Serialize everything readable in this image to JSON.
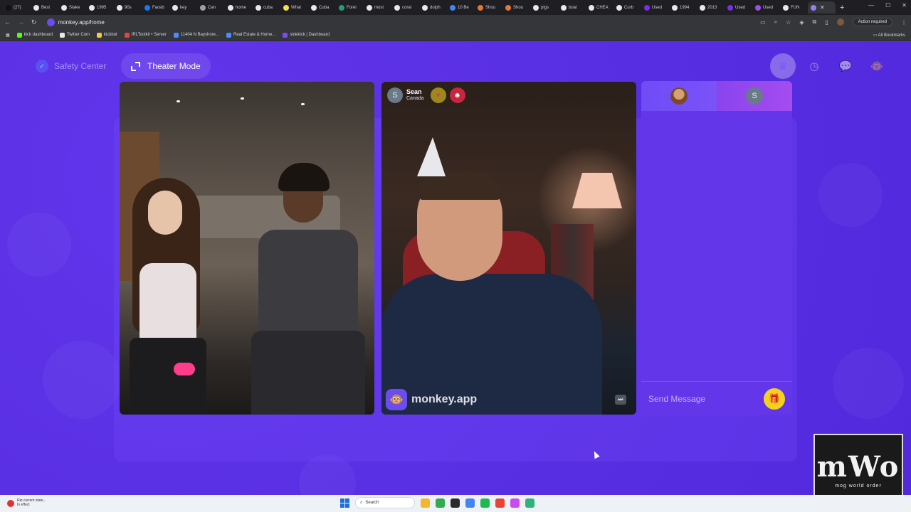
{
  "browser": {
    "tabs": [
      {
        "label": "(27)",
        "favicon_color": "#111111"
      },
      {
        "label": "Best",
        "favicon_color": "#e8e8e8"
      },
      {
        "label": "Stake",
        "favicon_color": "#e8e8e8"
      },
      {
        "label": "1995",
        "favicon_color": "#e8e8e8"
      },
      {
        "label": "90s",
        "favicon_color": "#e8e8e8"
      },
      {
        "label": "Faceb",
        "favicon_color": "#1877f2"
      },
      {
        "label": "key",
        "favicon_color": "#e8e8e8"
      },
      {
        "label": "Can",
        "favicon_color": "#9aa0a6"
      },
      {
        "label": "home",
        "favicon_color": "#e8e8e8"
      },
      {
        "label": "cuba",
        "favicon_color": "#e8e8e8"
      },
      {
        "label": "What",
        "favicon_color": "#f4e04d"
      },
      {
        "label": "Cuba",
        "favicon_color": "#e8e8e8"
      },
      {
        "label": "Forei",
        "favicon_color": "#22a06b"
      },
      {
        "label": "most",
        "favicon_color": "#e8e8e8"
      },
      {
        "label": "coral",
        "favicon_color": "#e8e8e8"
      },
      {
        "label": "dolph",
        "favicon_color": "#e8e8e8"
      },
      {
        "label": "10 Be",
        "favicon_color": "#4285f4"
      },
      {
        "label": "Shou",
        "favicon_color": "#e8772e"
      },
      {
        "label": "Shou",
        "favicon_color": "#e8772e"
      },
      {
        "label": "pigs",
        "favicon_color": "#e8e8e8"
      },
      {
        "label": "boat",
        "favicon_color": "#e8e8e8"
      },
      {
        "label": "CHEA",
        "favicon_color": "#e8e8e8"
      },
      {
        "label": "Curb",
        "favicon_color": "#e8e8e8"
      },
      {
        "label": "Used",
        "favicon_color": "#7a2ee8"
      },
      {
        "label": "1994",
        "favicon_color": "#e8e8e8"
      },
      {
        "label": "2013",
        "favicon_color": "#e8e8e8"
      },
      {
        "label": "Used",
        "favicon_color": "#7a2ee8"
      },
      {
        "label": "Used",
        "favicon_color": "#a24ce8"
      },
      {
        "label": "FUN",
        "favicon_color": "#e8e8e8"
      }
    ],
    "active_tab_favicon_color": "#9b7cf5",
    "url": "monkey.app/home",
    "action_required": "Action required",
    "bookmarks": [
      {
        "label": "kick dashboard",
        "color": "#53fc18"
      },
      {
        "label": "Twitter Com",
        "color": "#e8e8e8"
      },
      {
        "label": "kickbot",
        "color": "#f2c94c"
      },
      {
        "label": "IRLToolkit • Server",
        "color": "#e0463c"
      },
      {
        "label": "11404 N Bayshore...",
        "color": "#4a8cff"
      },
      {
        "label": "Real Estate & Home...",
        "color": "#4a8cff"
      },
      {
        "label": "sidekick | Dashboard",
        "color": "#7a4cf0"
      }
    ],
    "all_bookmarks": "All Bookmarks"
  },
  "header": {
    "safety_center": "Safety Center",
    "theater_mode": "Theater Mode",
    "icons": [
      "crown-icon",
      "history-icon",
      "chat-bubble-icon",
      "monkey-avatar-icon"
    ]
  },
  "remote_video": {
    "user_initial": "S",
    "user_name": "Sean",
    "user_country": "Canada",
    "watermark": "monkey.app"
  },
  "chat": {
    "partner_initial": "S",
    "placeholder": "Send Message"
  },
  "overlay_logo": {
    "main": "mWo",
    "sub": "mog world order"
  },
  "taskbar": {
    "notif_title": "Rip current state...",
    "notif_sub": "In effect",
    "search": "Search",
    "apps": [
      {
        "name": "file-explorer",
        "color": "#f2b632"
      },
      {
        "name": "chrome",
        "color": "#34a853"
      },
      {
        "name": "obs",
        "color": "#2b2b2b"
      },
      {
        "name": "chrome-2",
        "color": "#4285f4"
      },
      {
        "name": "spotify",
        "color": "#1db954"
      },
      {
        "name": "chrome-3",
        "color": "#ea4335"
      },
      {
        "name": "chrome-active",
        "color": "#c94cf0"
      },
      {
        "name": "notes",
        "color": "#2fb37a"
      }
    ]
  }
}
